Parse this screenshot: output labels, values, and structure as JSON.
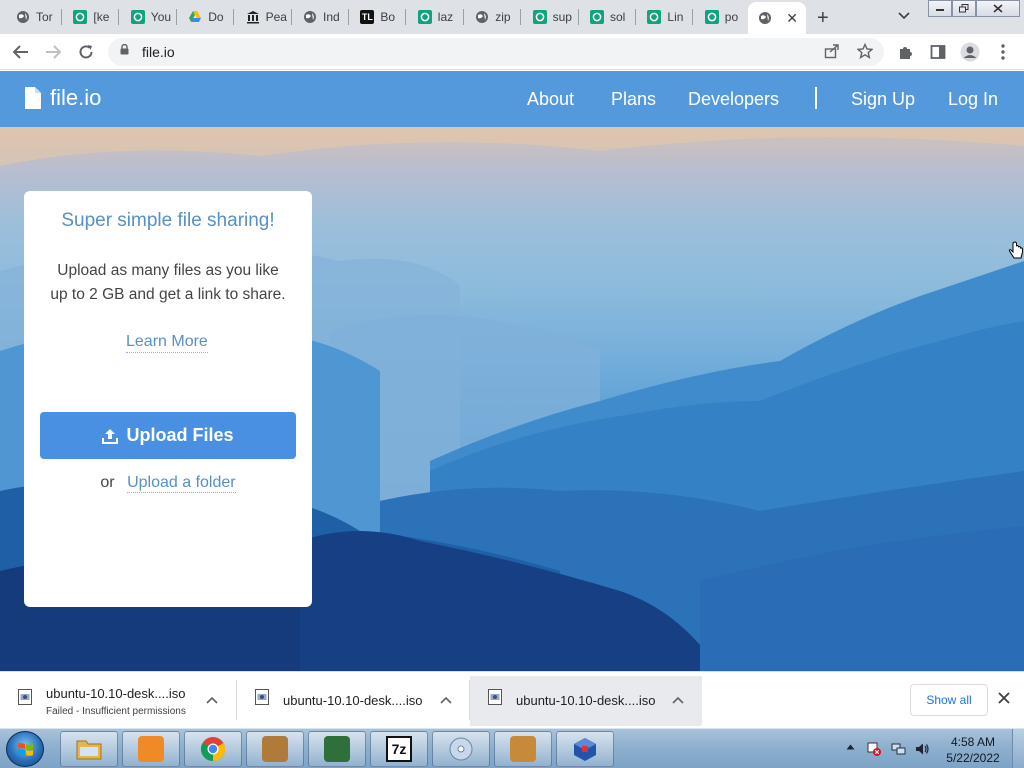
{
  "browser": {
    "tabs": [
      {
        "title": "Tor",
        "icon": "globe-icon",
        "color": "#5f6368"
      },
      {
        "title": "[ke",
        "icon": "openai-icon",
        "color": "#10a37f"
      },
      {
        "title": "You",
        "icon": "openai-icon",
        "color": "#10a37f"
      },
      {
        "title": "Do",
        "icon": "google-drive-icon",
        "color": "#34a853"
      },
      {
        "title": "Pea",
        "icon": "library-icon",
        "color": "#222222"
      },
      {
        "title": "Ind",
        "icon": "globe-icon",
        "color": "#5f6368"
      },
      {
        "title": "Bo",
        "icon": "tl-icon",
        "color": "#111111"
      },
      {
        "title": "laz",
        "icon": "openai-icon",
        "color": "#10a37f"
      },
      {
        "title": "zip",
        "icon": "globe-icon",
        "color": "#5f6368"
      },
      {
        "title": "sup",
        "icon": "openai-icon",
        "color": "#10a37f"
      },
      {
        "title": "sol",
        "icon": "openai-icon",
        "color": "#10a37f"
      },
      {
        "title": "Lin",
        "icon": "openai-icon",
        "color": "#10a37f"
      },
      {
        "title": "po",
        "icon": "openai-icon",
        "color": "#10a37f"
      }
    ],
    "active_tab": {
      "icon": "globe-icon",
      "close": "✕"
    },
    "new_tab": "+",
    "url": "file.io"
  },
  "site": {
    "brand": "file.io",
    "nav": {
      "about": "About",
      "plans": "Plans",
      "developers": "Developers",
      "signup": "Sign Up",
      "login": "Log In"
    },
    "nav_color": "#5599dd",
    "accent": "#4a90e2"
  },
  "card": {
    "title": "Super simple file sharing!",
    "desc_line1": "Upload as many files as you like",
    "desc_line2": "up to 2 GB and get a link to share.",
    "learn_more": "Learn More",
    "upload_button": "Upload Files",
    "or": "or",
    "upload_folder": "Upload a folder"
  },
  "downloads": {
    "items": [
      {
        "name": "ubuntu-10.10-desk....iso",
        "status": "Failed - Insufficient permissions"
      },
      {
        "name": "ubuntu-10.10-desk....iso",
        "status": ""
      },
      {
        "name": "ubuntu-10.10-desk....iso",
        "status": ""
      }
    ],
    "show_all": "Show all"
  },
  "taskbar": {
    "apps": [
      {
        "name": "explorer",
        "icon": "folder-icon",
        "color": "#e8b54a"
      },
      {
        "name": "media",
        "icon": "media-player-icon",
        "color": "#f08a24"
      },
      {
        "name": "chrome",
        "icon": "chrome-icon",
        "color": "#db4437"
      },
      {
        "name": "user",
        "icon": "user-computer-icon",
        "color": "#b07a3a"
      },
      {
        "name": "monitor",
        "icon": "monitor-icon",
        "color": "#2f6f3a"
      },
      {
        "name": "7zip",
        "icon": "7zip-icon",
        "color": "#111111",
        "label": "7z"
      },
      {
        "name": "disc",
        "icon": "disc-icon",
        "color": "#8aa9c9"
      },
      {
        "name": "paint",
        "icon": "paint-icon",
        "color": "#c68a3a"
      },
      {
        "name": "virtualbox",
        "icon": "cube-icon",
        "color": "#2255aa"
      }
    ],
    "time": "4:58 AM",
    "date": "5/22/2022"
  }
}
